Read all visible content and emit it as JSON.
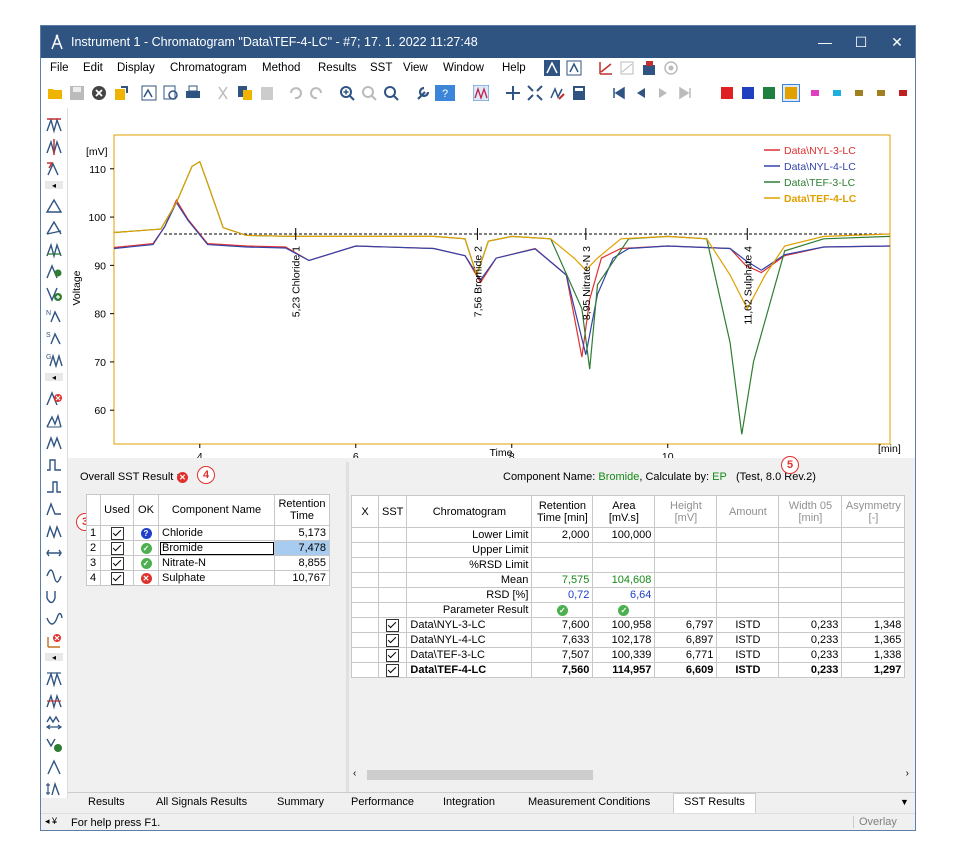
{
  "window": {
    "title": "Instrument 1 - Chromatogram \"Data\\TEF-4-LC\" - #7;   17. 1. 2022   11:27:48",
    "minimize": "—",
    "maximize": "☐",
    "close": "✕"
  },
  "menu": [
    "File",
    "Edit",
    "Display",
    "Chromatogram",
    "Method",
    "Results",
    "SST",
    "View",
    "Window",
    "Help"
  ],
  "colors": {
    "titlebar": "#2f5482",
    "series_red": "#e03030",
    "series_blue": "#3344aa",
    "series_green": "#2e7d32",
    "series_gold": "#e0a000",
    "accent_green": "#168a16",
    "accent_blue": "#1d3fc9",
    "error_red": "#e0322d"
  },
  "toolbar_color_swatches": [
    "#e02020",
    "#2040c0",
    "#208040",
    "#e0a000",
    "#e040c0",
    "#20b0e0",
    "#a08020",
    "#c02020"
  ],
  "chart_data": {
    "type": "line",
    "ylabel": "Voltage",
    "yunit": "[mV]",
    "xlabel": "Time",
    "xunit": "[min]",
    "xlim": [
      2.9,
      12.85
    ],
    "ylim": [
      53,
      117
    ],
    "xticks": [
      "4",
      "6",
      "8",
      "10"
    ],
    "yticks": [
      "60",
      "70",
      "80",
      "90",
      "100",
      "110"
    ],
    "legend": [
      "Data\\NYL-3-LC",
      "Data\\NYL-4-LC",
      "Data\\TEF-3-LC",
      "Data\\TEF-4-LC"
    ],
    "legend_placement": "top-right",
    "series": [
      {
        "name": "Data\\NYL-3-LC",
        "x": [
          2.9,
          3.4,
          3.55,
          3.7,
          3.85,
          4.1,
          4.6,
          5.1,
          5.4,
          6.0,
          7.0,
          7.4,
          7.6,
          7.8,
          8.3,
          8.7,
          8.9,
          9.0,
          9.15,
          9.4,
          10.0,
          10.8,
          11.0,
          11.2,
          11.5,
          12.0,
          12.85
        ],
        "y": [
          93.7,
          94.5,
          98,
          103.5,
          99.5,
          94.5,
          94,
          93.8,
          91,
          94,
          93.5,
          92,
          86.5,
          91.5,
          93.5,
          88,
          71,
          83,
          91.5,
          93.5,
          94,
          93.5,
          90,
          88.5,
          92,
          93.8,
          94
        ]
      },
      {
        "name": "Data\\NYL-4-LC",
        "x": [
          2.9,
          3.4,
          3.55,
          3.7,
          3.85,
          4.1,
          4.6,
          5.1,
          5.4,
          6.0,
          7.0,
          7.4,
          7.6,
          7.8,
          8.3,
          8.7,
          8.95,
          9.1,
          9.3,
          9.5,
          10.0,
          10.8,
          11.0,
          11.2,
          11.5,
          12.0,
          12.85
        ],
        "y": [
          93.5,
          94.3,
          98,
          103,
          99.3,
          94.3,
          93.8,
          93.6,
          91,
          94,
          93.5,
          92,
          87,
          91.5,
          93.4,
          88,
          71.5,
          84,
          91.5,
          93.5,
          94,
          93.5,
          91,
          89,
          92.2,
          93.8,
          94
        ]
      },
      {
        "name": "Data\\TEF-3-LC",
        "x": [
          2.9,
          3.5,
          3.7,
          3.9,
          4.0,
          4.1,
          4.3,
          4.6,
          5.2,
          6.0,
          7.0,
          7.4,
          7.55,
          7.7,
          8.0,
          8.5,
          8.9,
          9.0,
          9.1,
          9.5,
          10.0,
          10.5,
          10.8,
          10.95,
          11.1,
          11.5,
          12.0,
          12.85
        ],
        "y": [
          96.8,
          97.5,
          103,
          110.5,
          111.5,
          107,
          97.8,
          96.2,
          96,
          96,
          96,
          95.5,
          88,
          95,
          96,
          95.5,
          81,
          68.5,
          86,
          95.5,
          96,
          95.5,
          74,
          55,
          70,
          93,
          95.5,
          96
        ]
      },
      {
        "name": "Data\\TEF-4-LC",
        "x": [
          2.9,
          3.5,
          3.7,
          3.9,
          4.0,
          4.1,
          4.3,
          4.6,
          5.2,
          6.0,
          7.0,
          7.4,
          7.55,
          7.7,
          8.0,
          8.5,
          8.8,
          8.95,
          9.1,
          9.4,
          10.0,
          10.5,
          10.8,
          11.02,
          11.25,
          11.5,
          12.0,
          12.85
        ],
        "y": [
          96.8,
          97.5,
          103,
          110.5,
          111.5,
          107,
          97.8,
          96.2,
          96,
          96,
          96,
          95.5,
          88,
          95,
          96,
          95.5,
          91.5,
          89,
          91.5,
          95.5,
          96,
          95.5,
          88,
          81,
          88,
          94,
          96,
          96.5
        ]
      }
    ],
    "baseline": {
      "x": [
        2.9,
        12.85
      ],
      "y": [
        96.5,
        96.5
      ]
    },
    "peak_labels": [
      "5,23 Chloride   1",
      "7,56 Bromide   2",
      "8,95 Nitrate-N   3",
      "11,02 Sulphate   4"
    ],
    "peak_times": [
      5.23,
      7.56,
      8.95,
      11.02
    ]
  },
  "left_panel": {
    "overall_label": "Overall SST Result :",
    "badge4": "4",
    "badge3": "3",
    "headers": [
      "",
      "Used",
      "OK",
      "Component Name",
      "Retention Time"
    ],
    "rows": [
      {
        "n": "1",
        "name": "Chloride",
        "rt": "5,173",
        "ok": "info"
      },
      {
        "n": "2",
        "name": "Bromide",
        "rt": "7,478",
        "ok": "ok"
      },
      {
        "n": "3",
        "name": "Nitrate-N",
        "rt": "8,855",
        "ok": "ok"
      },
      {
        "n": "4",
        "name": "Sulphate",
        "rt": "10,767",
        "ok": "err"
      }
    ]
  },
  "right_panel": {
    "component_prefix": "Component Name: ",
    "component_name": "Bromide",
    "calc_prefix": ", Calculate by: ",
    "calc_by": "EP",
    "test_label": "(Test, 8.0 Rev.2)",
    "badge1": "1",
    "badge2": "2",
    "badge5": "5",
    "headers": [
      "X",
      "SST",
      "Chromatogram",
      "Retention Time [min]",
      "Area [mV.s]",
      "Height [mV]",
      "Amount",
      "Width 05 [min]",
      "Asymmetry [-]"
    ],
    "limits": [
      {
        "label": "Lower Limit",
        "rt": "2,000",
        "area": "100,000"
      },
      {
        "label": "Upper Limit",
        "rt": "",
        "area": ""
      },
      {
        "label": "%RSD Limit",
        "rt": "",
        "area": ""
      }
    ],
    "mean": {
      "label": "Mean",
      "rt": "7,575",
      "area": "104,608"
    },
    "rsd": {
      "label": "RSD [%]",
      "rt": "0,72",
      "area": "6,64"
    },
    "param_label": "Parameter Result",
    "data_rows": [
      {
        "name": "Data\\NYL-3-LC",
        "rt": "7,600",
        "area": "100,958",
        "height": "6,797",
        "amount": "ISTD",
        "width": "0,233",
        "asym": "1,348",
        "bold": false
      },
      {
        "name": "Data\\NYL-4-LC",
        "rt": "7,633",
        "area": "102,178",
        "height": "6,897",
        "amount": "ISTD",
        "width": "0,233",
        "asym": "1,365",
        "bold": false
      },
      {
        "name": "Data\\TEF-3-LC",
        "rt": "7,507",
        "area": "100,339",
        "height": "6,771",
        "amount": "ISTD",
        "width": "0,233",
        "asym": "1,338",
        "bold": false
      },
      {
        "name": "Data\\TEF-4-LC",
        "rt": "7,560",
        "area": "114,957",
        "height": "6,609",
        "amount": "ISTD",
        "width": "0,233",
        "asym": "1,297",
        "bold": true
      }
    ]
  },
  "tabs": [
    "Results",
    "All Signals Results",
    "Summary",
    "Performance",
    "Integration",
    "Measurement Conditions",
    "SST Results"
  ],
  "active_tab": "SST Results",
  "status": {
    "help": "For help press F1.",
    "overlay": "Overlay"
  }
}
